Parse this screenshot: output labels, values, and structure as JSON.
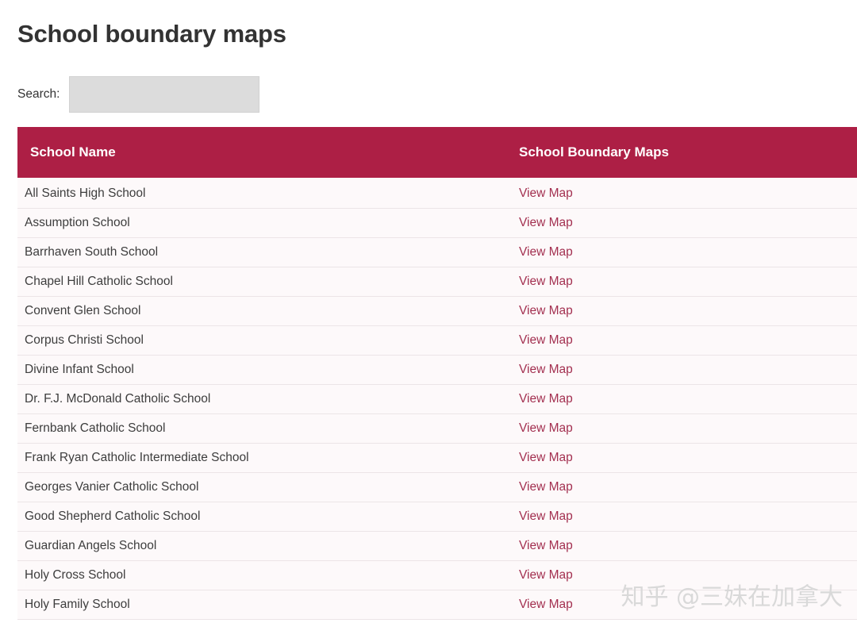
{
  "page": {
    "title": "School boundary maps"
  },
  "search": {
    "label": "Search:",
    "value": "",
    "placeholder": ""
  },
  "table": {
    "columns": [
      "School Name",
      "School Boundary Maps"
    ],
    "link_label": "View Map",
    "rows": [
      {
        "school_name": "All Saints High School",
        "map_link": "View Map"
      },
      {
        "school_name": "Assumption School",
        "map_link": "View Map"
      },
      {
        "school_name": "Barrhaven South School",
        "map_link": "View Map"
      },
      {
        "school_name": "Chapel Hill Catholic School",
        "map_link": "View Map"
      },
      {
        "school_name": "Convent Glen School",
        "map_link": "View Map"
      },
      {
        "school_name": "Corpus Christi School",
        "map_link": "View Map"
      },
      {
        "school_name": "Divine Infant School",
        "map_link": "View Map"
      },
      {
        "school_name": "Dr. F.J. McDonald Catholic School",
        "map_link": "View Map"
      },
      {
        "school_name": "Fernbank Catholic School",
        "map_link": "View Map"
      },
      {
        "school_name": "Frank Ryan Catholic Intermediate School",
        "map_link": "View Map"
      },
      {
        "school_name": "Georges Vanier Catholic School",
        "map_link": "View Map"
      },
      {
        "school_name": "Good Shepherd Catholic School",
        "map_link": "View Map"
      },
      {
        "school_name": "Guardian Angels School",
        "map_link": "View Map"
      },
      {
        "school_name": "Holy Cross School",
        "map_link": "View Map"
      },
      {
        "school_name": "Holy Family School",
        "map_link": "View Map"
      }
    ]
  },
  "watermark": {
    "text": "知乎 @三妹在加拿大"
  },
  "colors": {
    "header_background": "#ad1f45",
    "header_text": "#ffffff",
    "link": "#a33050",
    "table_background": "#fdf9fa",
    "row_divider": "#ece5e7",
    "title_text": "#333333",
    "search_input_background": "#dcdcdc",
    "watermark_text": "#d9d9d9"
  }
}
